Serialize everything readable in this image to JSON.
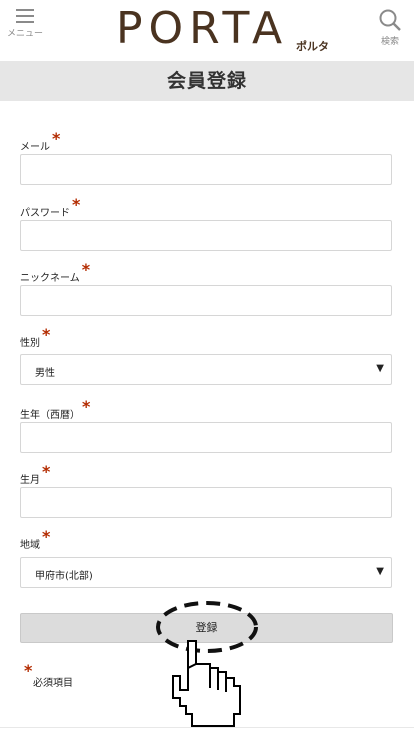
{
  "header": {
    "menu_label": "メニュー",
    "logo_text": "PORTA",
    "logo_sub": "ポルタ",
    "search_label": "検索"
  },
  "page_title": "会員登録",
  "form": {
    "required_mark": "*",
    "fields": [
      {
        "label": "メール",
        "type": "text",
        "value": ""
      },
      {
        "label": "パスワード",
        "type": "password",
        "value": ""
      },
      {
        "label": "ニックネーム",
        "type": "text",
        "value": ""
      },
      {
        "label": "性別",
        "type": "select",
        "value": "男性"
      },
      {
        "label": "生年（西暦）",
        "type": "text",
        "value": ""
      },
      {
        "label": "生月",
        "type": "text",
        "value": ""
      },
      {
        "label": "地域",
        "type": "select",
        "value": "甲府市(北部)"
      }
    ],
    "submit_label": "登録",
    "required_note": "必須項目"
  },
  "colors": {
    "brand": "#4a3320",
    "required": "#b32b00",
    "title_bar": "#e6e6e6",
    "button": "#dcdcdc"
  },
  "icons": {
    "menu": "hamburger-icon",
    "search": "magnifier-icon",
    "pointer": "hand-pointer-icon"
  }
}
